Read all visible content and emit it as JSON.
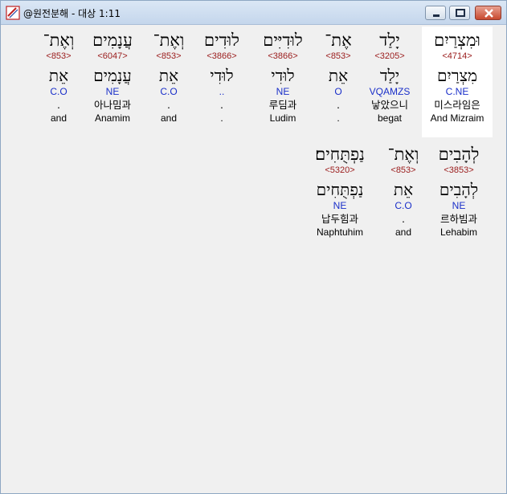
{
  "window": {
    "title": "@원전분해 - 대상 1:11",
    "controls": {
      "minimize": "minimize",
      "maximize": "maximize",
      "close": "close"
    }
  },
  "rows": [
    {
      "words": [
        {
          "heb": "וּמִצְרַיִם",
          "strong": "<4714>",
          "heb_root": "מִצְרַיִם",
          "code": "C.NE",
          "kor": "미스라임은",
          "eng": "And Mizraim",
          "selected": true
        },
        {
          "heb": "יָלַד",
          "strong": "<3205>",
          "heb_root": "יָלַד",
          "code": "VQAMZS",
          "kor": "낳았으니",
          "eng": "begat"
        },
        {
          "heb": "אֶת־",
          "strong": "<853>",
          "heb_root": "אֵת",
          "code": "O",
          "kor": ".",
          "eng": "."
        },
        {
          "heb": "לוּדִיִּים",
          "strong": "<3866>",
          "heb_root": "לוּדִי",
          "code": "NE",
          "kor": "루딤과",
          "eng": "Ludim"
        },
        {
          "heb": "לוּדִים",
          "strong": "<3866>",
          "heb_root": "לוּדִי",
          "code": "..",
          "kor": ".",
          "eng": "."
        },
        {
          "heb": "וְאֶת־",
          "strong": "<853>",
          "heb_root": "אֵת",
          "code": "C.O",
          "kor": ".",
          "eng": "and"
        },
        {
          "heb": "עֲנָמִים",
          "strong": "<6047>",
          "heb_root": "עֲנָמִים",
          "code": "NE",
          "kor": "아나밈과",
          "eng": "Anamim"
        },
        {
          "heb": "וְאֶת־",
          "strong": "<853>",
          "heb_root": "אֵת",
          "code": "C.O",
          "kor": ".",
          "eng": "and"
        }
      ]
    },
    {
      "words": [
        {
          "heb": "לְהָבִים",
          "strong": "<3853>",
          "heb_root": "לְהָבִים",
          "code": "NE",
          "kor": "르하빔과",
          "eng": "Lehabim"
        },
        {
          "heb": "וְאֶת־",
          "strong": "<853>",
          "heb_root": "אֵת",
          "code": "C.O",
          "kor": ".",
          "eng": "and"
        },
        {
          "heb": "נַפְתֻּחִים׃",
          "strong": "<5320>",
          "heb_root": "נַפְתֻּחִים",
          "code": "NE",
          "kor": "납두힘과",
          "eng": "Naphtuhim"
        }
      ]
    }
  ]
}
